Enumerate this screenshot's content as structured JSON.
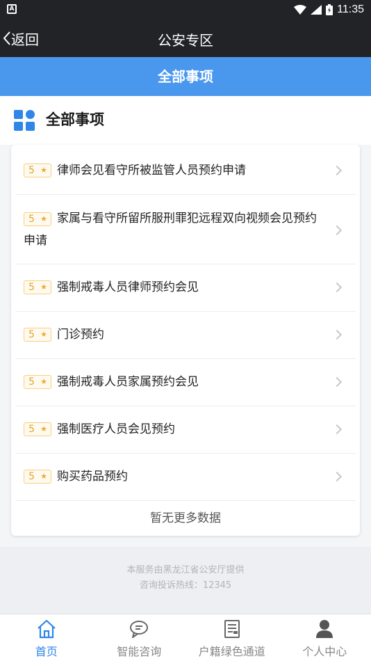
{
  "status_bar": {
    "time": "11:35",
    "notification_icon": "a-notification-icon"
  },
  "nav": {
    "back_label": "返回",
    "title": "公安专区"
  },
  "banner": {
    "title": "全部事项"
  },
  "section": {
    "title": "全部事项"
  },
  "items": [
    {
      "rating": "5",
      "label": "律师会见看守所被监管人员预约申请"
    },
    {
      "rating": "5",
      "label": "家属与看守所留所服刑罪犯远程双向视频会见预约申请"
    },
    {
      "rating": "5",
      "label": "强制戒毒人员律师预约会见"
    },
    {
      "rating": "5",
      "label": "门诊预约"
    },
    {
      "rating": "5",
      "label": "强制戒毒人员家属预约会见"
    },
    {
      "rating": "5",
      "label": "强制医疗人员会见预约"
    },
    {
      "rating": "5",
      "label": "购买药品预约"
    }
  ],
  "no_more": "暂无更多数据",
  "footer": {
    "line1": "本服务由黑龙江省公安厅提供",
    "line2": "咨询投诉热线：12345"
  },
  "tabs": [
    {
      "label": "首页",
      "icon": "home-icon",
      "active": true
    },
    {
      "label": "智能咨询",
      "icon": "chat-icon",
      "active": false
    },
    {
      "label": "户籍绿色通道",
      "icon": "document-icon",
      "active": false
    },
    {
      "label": "个人中心",
      "icon": "user-icon",
      "active": false
    }
  ],
  "colors": {
    "header_bg": "#222326",
    "banner_bg": "#4a97ee",
    "active_tab": "#2f86e8",
    "badge_text": "#e3a52b"
  }
}
